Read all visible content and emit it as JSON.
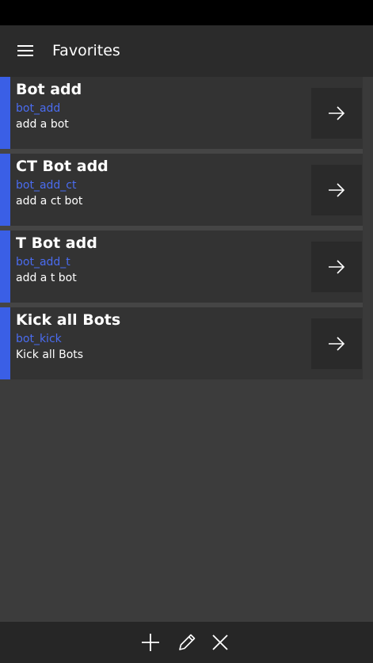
{
  "header": {
    "title": "Favorites",
    "menu_icon": "hamburger-menu-icon"
  },
  "favorites": [
    {
      "title": "Bot add",
      "command": "bot_add",
      "description": "add a bot"
    },
    {
      "title": "CT Bot add",
      "command": "bot_add_ct",
      "description": "add a ct bot"
    },
    {
      "title": "T Bot add",
      "command": "bot_add_t",
      "description": "add a t bot"
    },
    {
      "title": "Kick all Bots",
      "command": "bot_kick",
      "description": "Kick all Bots"
    }
  ],
  "item_action_icon": "arrow-right-icon",
  "bottom_bar": {
    "icons": [
      "plus-icon",
      "pencil-icon",
      "close-icon"
    ]
  },
  "colors": {
    "accent": "#3a5fe6",
    "command_text": "#4a6cf0",
    "background": "#3c3c3c",
    "item_background": "#333333",
    "header_background": "#2b2b2b"
  }
}
